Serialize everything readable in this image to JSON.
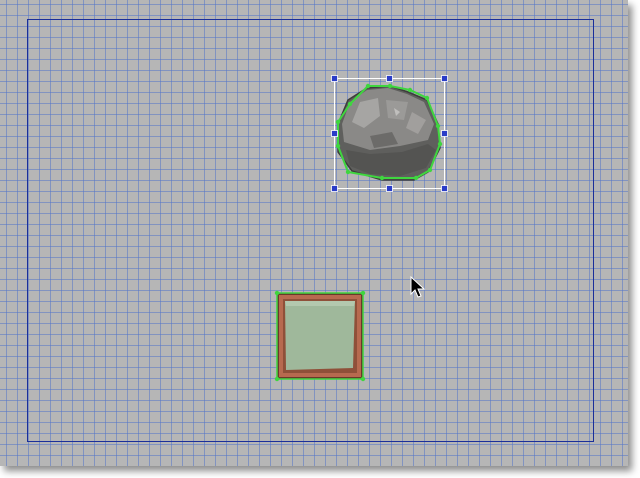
{
  "app": {
    "view": "level-editor-canvas",
    "grid_visible": true
  },
  "colors": {
    "canvas_background": "#b6b6b6",
    "grid_line": "#5676c8",
    "scene_bounds": "#1b2f9a",
    "collision_outline": "#3fd63f",
    "selection_handle": "#2a3cc8",
    "rock_fill": "#7b7a78",
    "platform_frame": "#b76a4f",
    "platform_fill": "#9fb89b"
  },
  "scene": {
    "objects": [
      {
        "id": "rock",
        "icon": "rock-sprite-icon",
        "selected": true,
        "handles": 8
      },
      {
        "id": "platform",
        "icon": "square-platform-icon",
        "selected": false
      }
    ],
    "cursor": "arrow-cursor-icon"
  }
}
